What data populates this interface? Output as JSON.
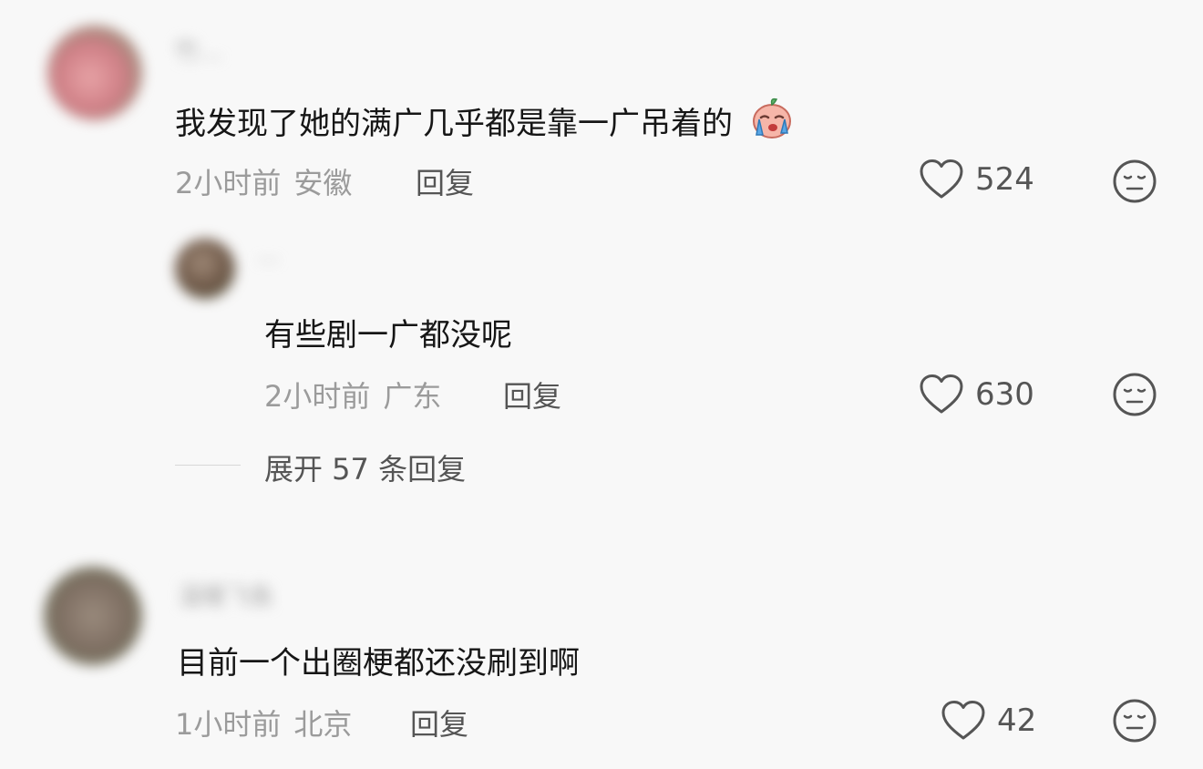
{
  "comments": [
    {
      "username": "竹…",
      "text": "我发现了她的满广几乎都是靠一广吊着的",
      "emoji": "crying-face-emoji",
      "time": "2小时前",
      "location": "安徽",
      "reply_label": "回复",
      "likes": "524"
    },
    {
      "username": "···",
      "text": "有些剧一广都没呢",
      "time": "2小时前",
      "location": "广东",
      "reply_label": "回复",
      "likes": "630"
    },
    {
      "username": "温暖飞鱼",
      "text": "目前一个出圈梗都还没刷到啊",
      "time": "1小时前",
      "location": "北京",
      "reply_label": "回复",
      "likes": "42"
    }
  ],
  "expand_replies": "展开 57 条回复",
  "colors": {
    "background": "#f8f8f8",
    "text": "#161616",
    "meta": "#9b9b9b",
    "action": "#555555"
  }
}
